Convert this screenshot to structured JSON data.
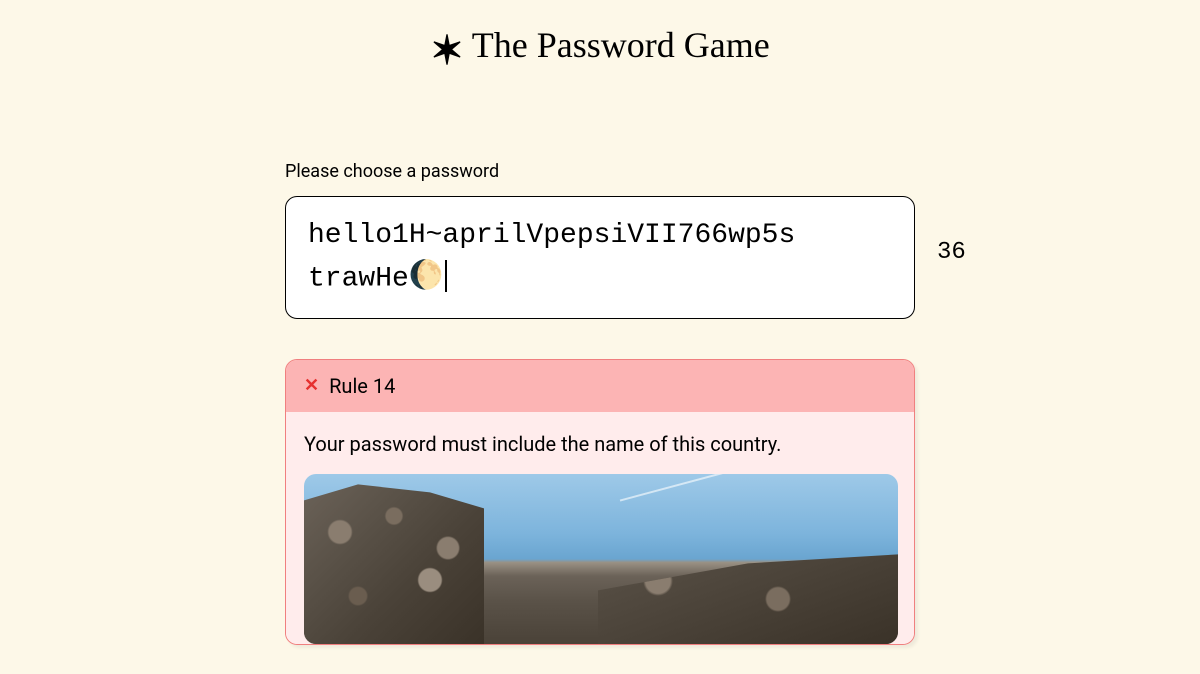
{
  "header": {
    "title": "The Password Game",
    "icon": "asterisk-icon"
  },
  "main": {
    "prompt_label": "Please choose a password",
    "password_value": "hello1H~aprilVpepsiVII766wp5strawHe🌔",
    "password_line1": "hello1H~aprilVpepsiVII766wp5s",
    "password_line2": "trawHe",
    "moon_emoji": "🌔",
    "char_count": "36"
  },
  "rule": {
    "status": "fail",
    "icon": "x-icon",
    "number_label": "Rule 14",
    "text": "Your password must include the name of this country.",
    "image_description": "stone-ruins-blue-sky"
  },
  "colors": {
    "background": "#fdf8e8",
    "rule_header_bg": "#fcb4b4",
    "rule_body_bg": "#ffecec",
    "rule_border": "#f07f7f",
    "x_icon": "#e6302f"
  }
}
